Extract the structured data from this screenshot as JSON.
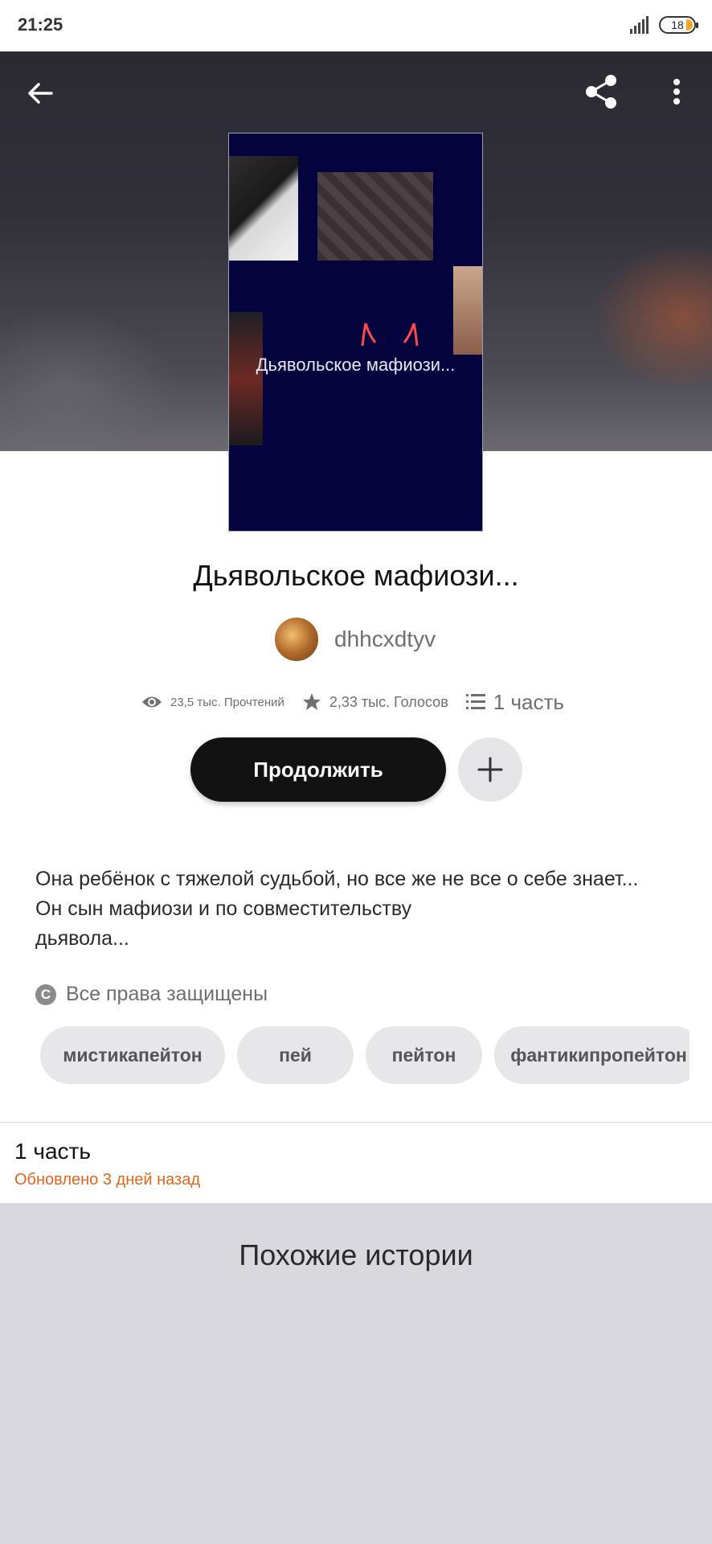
{
  "status_bar": {
    "time": "21:25",
    "battery": "18",
    "battery_color": "#f5a623"
  },
  "header": {
    "back_icon": "arrow-left-icon",
    "share_icon": "share-icon",
    "more_icon": "more-vertical-icon"
  },
  "cover": {
    "title": "Дьявольское мафиози..."
  },
  "story": {
    "title": "Дьявольское мафиози...",
    "author": "dhhcxdtyv",
    "reads": "23,5 тыс. Прочтений",
    "votes": "2,33 тыс. Голосов",
    "parts": "1 часть",
    "continue_label": "Продолжить",
    "description": [
      "Она ребёнок с тяжелой судьбой, но все же не все о себе знает...",
      "Он сын мафиози и по совместительству",
      "дьявола..."
    ],
    "copyright": "Все права защищены",
    "tags": [
      "мистикапейтон",
      "пей",
      "пейтон",
      "фантикипропейтон"
    ]
  },
  "parts_section": {
    "title": "1 часть",
    "updated": "Обновлено 3 дней назад",
    "updated_color": "#e0661b"
  },
  "similar": {
    "title": "Похожие истории"
  }
}
